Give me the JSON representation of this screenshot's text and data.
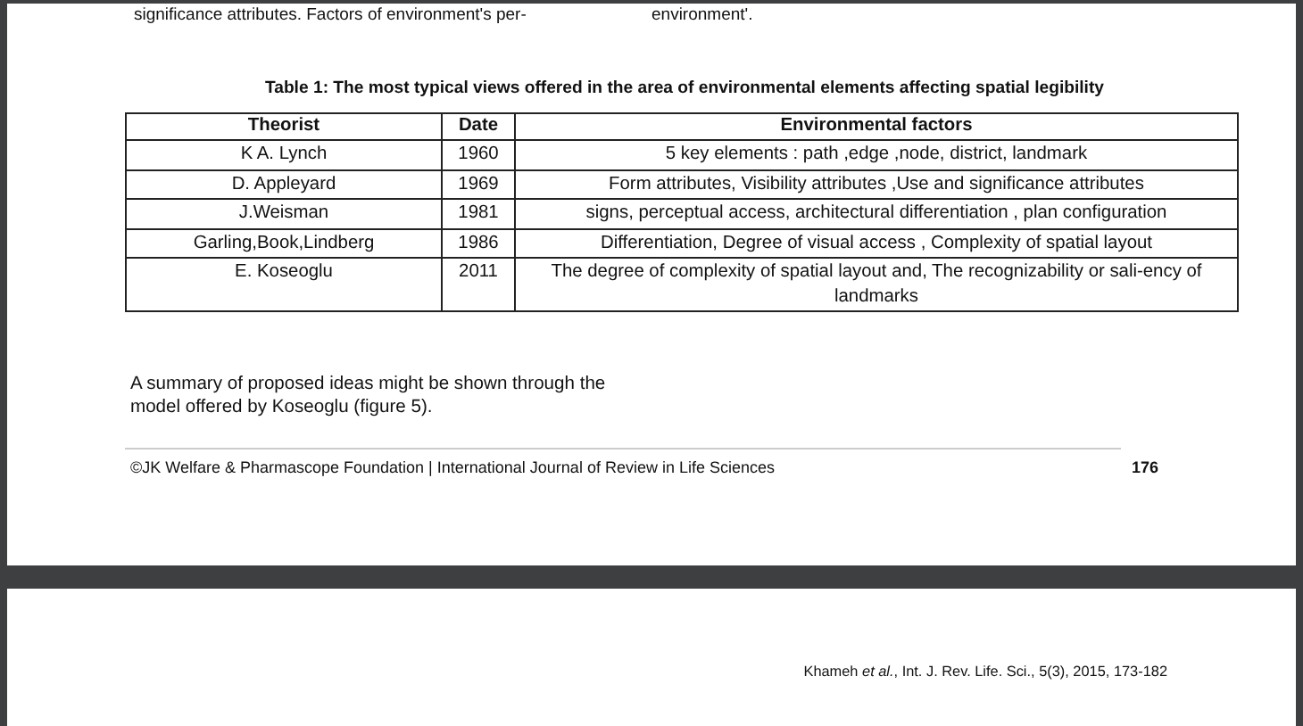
{
  "top_fragments": [
    "significance attributes. Factors of environment's per-",
    "environment'."
  ],
  "table": {
    "caption": "Table 1: The most typical views offered in the area of environmental elements affecting spatial legibility",
    "columns": [
      "Theorist",
      "Date",
      "Environmental factors"
    ],
    "rows": [
      [
        "K A. Lynch",
        "1960",
        "5 key elements : path ,edge ,node, district, landmark"
      ],
      [
        "D. Appleyard",
        "1969",
        "Form attributes, Visibility attributes ,Use and significance attributes"
      ],
      [
        "J.Weisman",
        "1981",
        "signs, perceptual access, architectural differentiation , plan configuration"
      ],
      [
        "Garling,Book,Lindberg",
        "1986",
        "Differentiation, Degree of visual access , Complexity of spatial layout"
      ],
      [
        "E. Koseoglu",
        "2011",
        "The degree of complexity of spatial layout and, The recognizability or sali-ency of landmarks"
      ]
    ]
  },
  "paragraph": "A summary of proposed ideas might be shown through the model offered by Koseoglu (figure 5).",
  "footer": {
    "text": "©JK Welfare & Pharmascope Foundation | International Journal of Review in Life Sciences",
    "page_number": "176"
  },
  "next_page": {
    "citation": "Khameh *et al.*, Int. J. Rev. Life. Sci., 5(3), 2015, 173-182"
  }
}
